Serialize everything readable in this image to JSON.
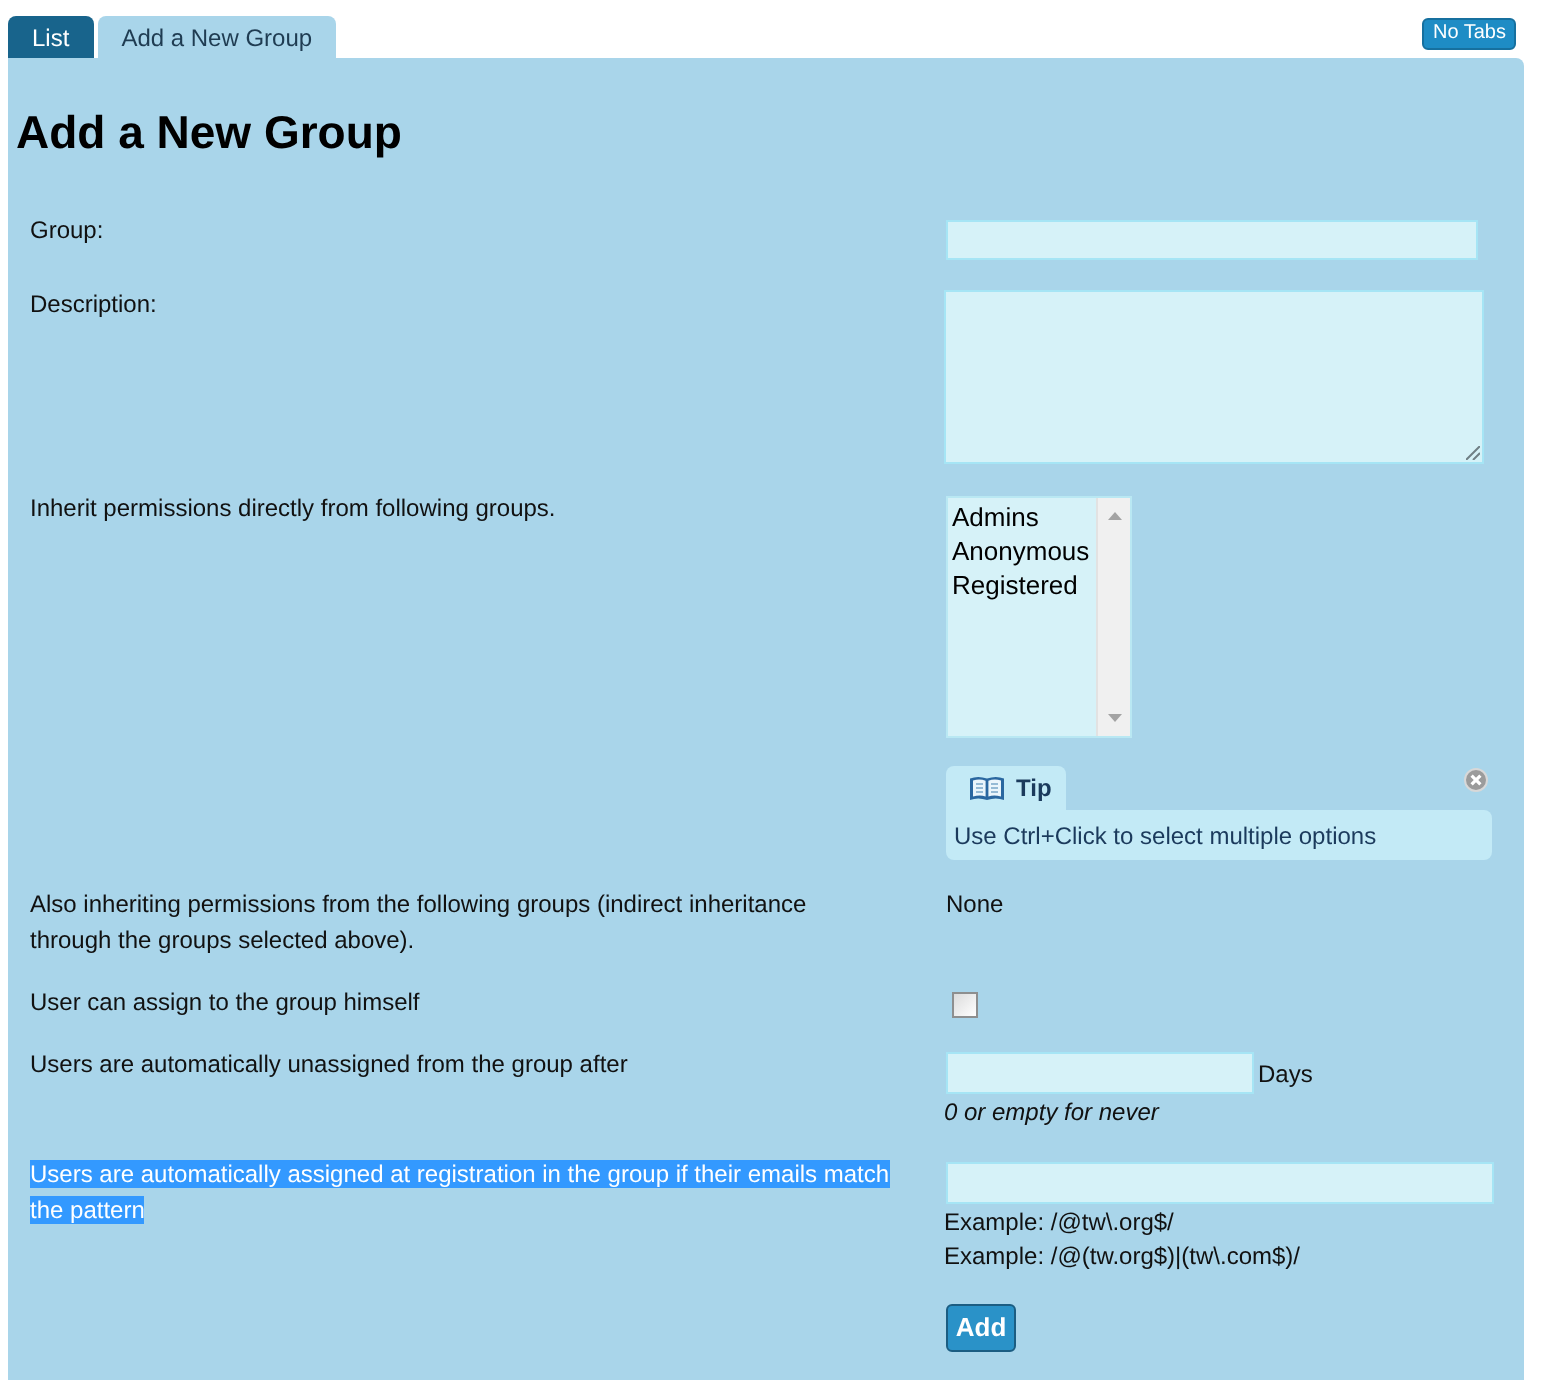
{
  "tabs": [
    {
      "label": "List",
      "selected": false
    },
    {
      "label": "Add a New Group",
      "selected": true
    }
  ],
  "no_tabs_button": "No Tabs",
  "title": "Add a New Group",
  "rows": [
    {
      "kind": "text",
      "label": "Group:",
      "highlighted": false
    },
    {
      "kind": "textarea",
      "label": "Description:",
      "highlighted": false
    },
    {
      "kind": "listbox",
      "label": "Inherit permissions directly from following groups.",
      "highlighted": false,
      "options": [
        {
          "label": "Admins",
          "selected": false
        },
        {
          "label": "Anonymous",
          "selected": false
        },
        {
          "label": "Registered",
          "selected": false
        }
      ],
      "tip": {
        "title": "Tip",
        "text": "Use Ctrl+Click to select multiple options"
      }
    },
    {
      "kind": "value",
      "label": "Also inheriting permissions from the following groups (indirect inheritance through the groups selected above).",
      "highlighted": false,
      "value": "None"
    },
    {
      "kind": "checkbox",
      "label": "User can assign to the group himself",
      "highlighted": false,
      "checked": false
    },
    {
      "kind": "duration",
      "label": "Users are automatically unassigned from the group after",
      "highlighted": false,
      "unit": "Days",
      "hint": "0 or empty for never"
    },
    {
      "kind": "pattern",
      "label": "Users are automatically assigned at registration in the group if their emails match the pattern",
      "highlighted": true,
      "examples": [
        "Example: /@tw\\.org$/",
        "Example: /@(tw.org$)|(tw\\.com$)/"
      ]
    }
  ],
  "submit": "Add"
}
